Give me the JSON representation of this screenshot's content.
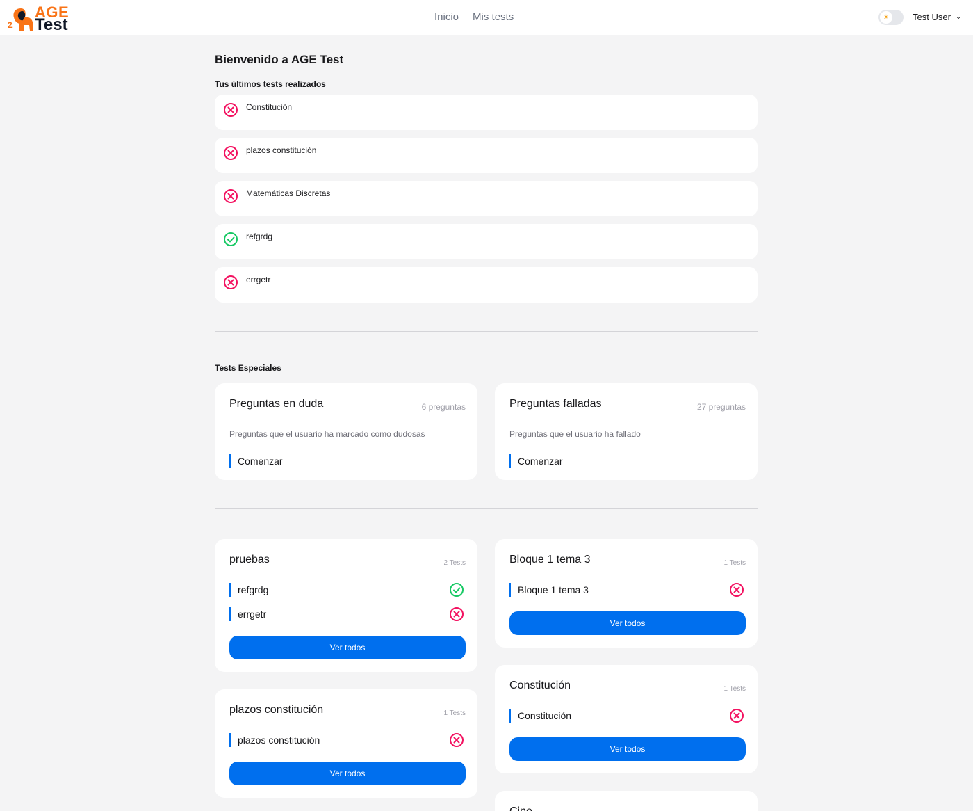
{
  "navbar": {
    "logo_line1": "AGE",
    "logo_line2": "Test",
    "logo_number": "2",
    "links": [
      "Inicio",
      "Mis tests"
    ],
    "user_name": "Test User"
  },
  "welcome_title": "Bienvenido a AGE Test",
  "recent": {
    "heading": "Tus últimos tests realizados",
    "items": [
      {
        "label": "Constitución",
        "status": "failed-icon"
      },
      {
        "label": "plazos constitución",
        "status": "failed-icon"
      },
      {
        "label": "Matemáticas Discretas",
        "status": "failed-icon"
      },
      {
        "label": "refgrdg",
        "status": "passed-icon"
      },
      {
        "label": "errgetr",
        "status": "failed-icon"
      }
    ]
  },
  "special": {
    "heading": "Tests Especiales",
    "cards": [
      {
        "title": "Preguntas en duda",
        "count": "6 preguntas",
        "description": "Preguntas que el usuario ha marcado como dudosas",
        "action": "Comenzar"
      },
      {
        "title": "Preguntas falladas",
        "count": "27 preguntas",
        "description": "Preguntas que el usuario ha fallado",
        "action": "Comenzar"
      }
    ]
  },
  "groups": [
    {
      "title": "pruebas",
      "count": "2 Tests",
      "items": [
        {
          "label": "refgrdg",
          "status": "passed-icon"
        },
        {
          "label": "errgetr",
          "status": "failed-icon"
        }
      ],
      "button": "Ver todos"
    },
    {
      "title": "Bloque 1 tema 3",
      "count": "1 Tests",
      "items": [
        {
          "label": "Bloque 1 tema 3",
          "status": "failed-icon"
        }
      ],
      "button": "Ver todos"
    },
    {
      "title": "plazos constitución",
      "count": "1 Tests",
      "items": [
        {
          "label": "plazos constitución",
          "status": "failed-icon"
        }
      ],
      "button": "Ver todos"
    },
    {
      "title": "Constitución",
      "count": "1 Tests",
      "items": [
        {
          "label": "Constitución",
          "status": "failed-icon"
        }
      ],
      "button": "Ver todos"
    },
    {
      "title": "Cine"
    }
  ],
  "colors": {
    "accent": "#006fee",
    "failed": "#f31260",
    "passed": "#17c964",
    "logo_orange": "#f97316"
  }
}
